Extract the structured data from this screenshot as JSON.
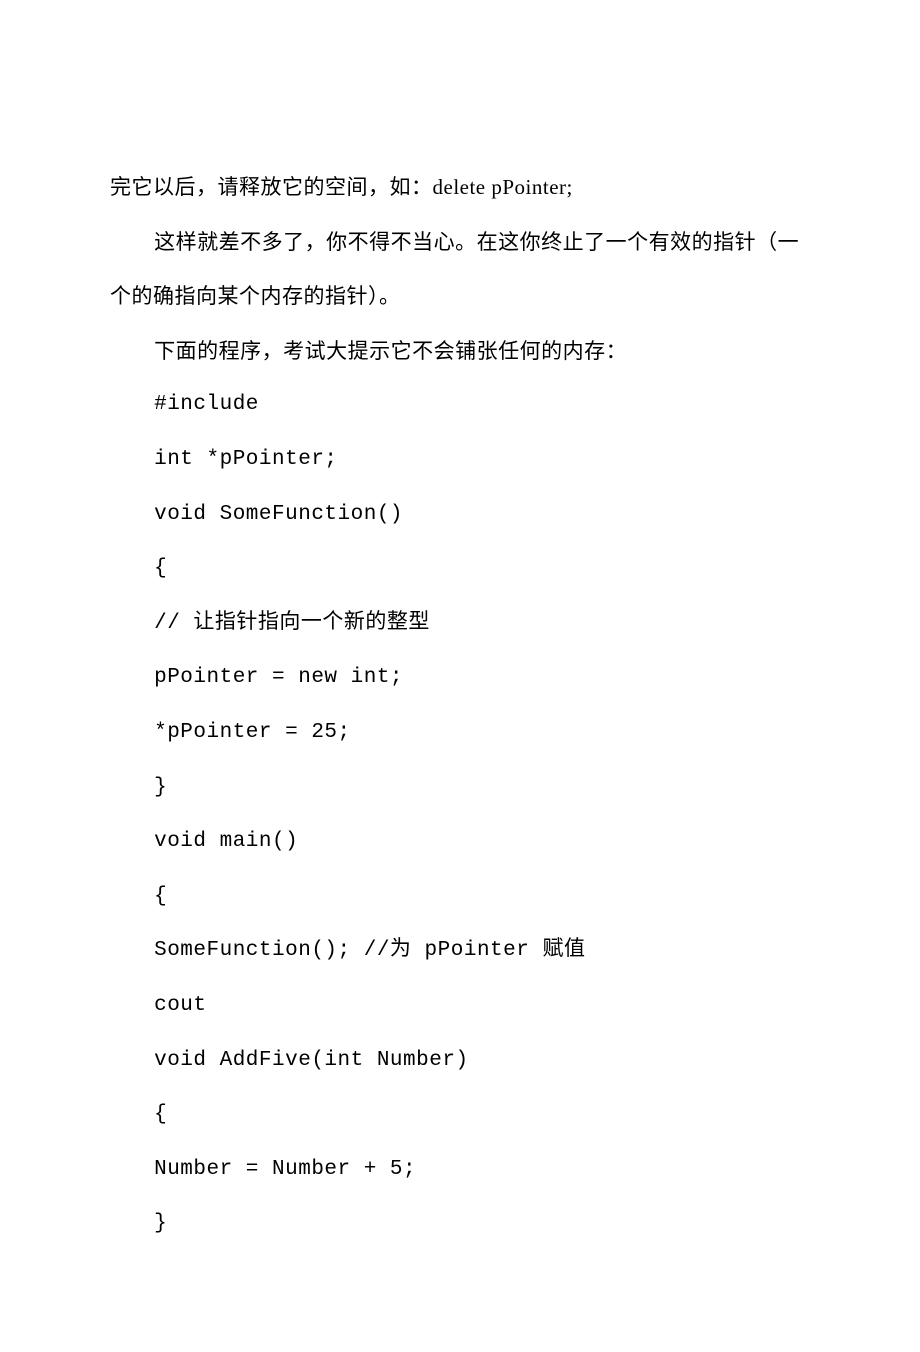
{
  "lines": [
    {
      "text": "完它以后，请释放它的空间，如：delete pPointer;",
      "indent": false,
      "code": false
    },
    {
      "text": "这样就差不多了，你不得不当心。在这你终止了一个有效的指针（一",
      "indent": true,
      "code": false
    },
    {
      "text": "个的确指向某个内存的指针）。",
      "indent": false,
      "code": false
    },
    {
      "text": "下面的程序，考试大提示它不会铺张任何的内存：",
      "indent": true,
      "code": false
    },
    {
      "text": "#include",
      "indent": true,
      "code": true
    },
    {
      "text": "int *pPointer;",
      "indent": true,
      "code": true
    },
    {
      "text": "void SomeFunction()",
      "indent": true,
      "code": true
    },
    {
      "text": "{",
      "indent": true,
      "code": true
    },
    {
      "text": "// 让指针指向一个新的整型",
      "indent": true,
      "code": true
    },
    {
      "text": "pPointer = new int;",
      "indent": true,
      "code": true
    },
    {
      "text": "*pPointer = 25;",
      "indent": true,
      "code": true
    },
    {
      "text": "}",
      "indent": true,
      "code": true
    },
    {
      "text": "void main()",
      "indent": true,
      "code": true
    },
    {
      "text": "{",
      "indent": true,
      "code": true
    },
    {
      "text": "SomeFunction(); //为 pPointer 赋值",
      "indent": true,
      "code": true
    },
    {
      "text": "cout",
      "indent": true,
      "code": true
    },
    {
      "text": "void AddFive(int Number)",
      "indent": true,
      "code": true
    },
    {
      "text": "{",
      "indent": true,
      "code": true
    },
    {
      "text": "Number = Number + 5;",
      "indent": true,
      "code": true
    },
    {
      "text": "}",
      "indent": true,
      "code": true
    }
  ]
}
